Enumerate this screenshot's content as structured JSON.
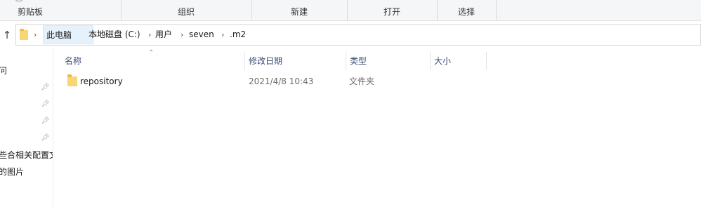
{
  "ribbon": {
    "groups": [
      "剪贴板",
      "组织",
      "新建",
      "打开",
      "选择"
    ]
  },
  "address": {
    "crumbs": [
      "此电脑",
      "本地磁盘 (C:)",
      "用户",
      "seven",
      ".m2"
    ],
    "up_icon": "arrow-up-icon",
    "folder_icon": "folder-icon",
    "chevron_icon": "chevron-right-icon"
  },
  "nav": {
    "items": [
      "问",
      "些合相关配置文",
      "的图片"
    ],
    "pin_icon": "pin-icon"
  },
  "columns": {
    "name": "名称",
    "date": "修改日期",
    "type": "类型",
    "size": "大小"
  },
  "files": [
    {
      "name": "repository",
      "date": "2021/4/8 10:43",
      "type": "文件夹",
      "size": ""
    }
  ],
  "colors": {
    "header_text": "#3c4d73",
    "folder": "#f7d673",
    "breadcrumb_highlight": "#e5f1fb"
  }
}
